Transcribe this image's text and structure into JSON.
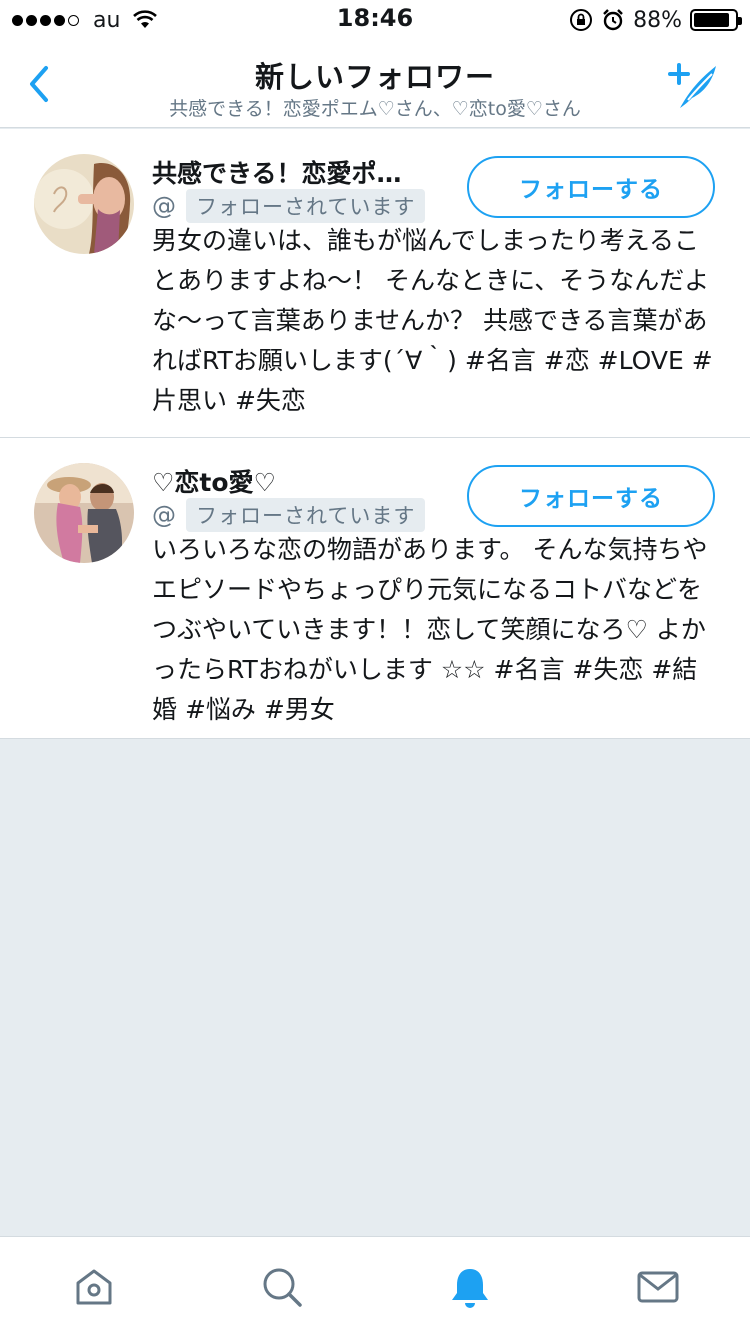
{
  "status_bar": {
    "carrier": "au",
    "time": "18:46",
    "battery_percent": "88%",
    "battery_level": 0.88,
    "signal_dots_filled": 4,
    "signal_dots_total": 5
  },
  "header": {
    "title": "新しいフォロワー",
    "subtitle": "共感できる！恋愛ポエム♡さん、♡恋to愛♡さん",
    "back_icon": "chevron-left-icon",
    "compose_icon": "compose-tweet-icon"
  },
  "followers": [
    {
      "name": "共感できる！恋愛ポ…",
      "handle_prefix": "@",
      "follows_you": "フォローされています",
      "follow_button": "フォローする",
      "bio": "男女の違いは、誰もが悩んでしまったり考えることありますよね〜！ そんなときに、そうなんだよな〜って言葉ありませんか？ 共感できる言葉があればRTお願いします(´∀｀) #名言 #恋 #LOVE #片思い #失恋"
    },
    {
      "name": "♡恋to愛♡",
      "handle_prefix": "@",
      "follows_you": "フォローされています",
      "follow_button": "フォローする",
      "bio": "いろいろな恋の物語があります。 そんな気持ちやエピソードやちょっぴり元気になるコトバなどをつぶやいていきます！！恋して笑顔になろ♡ よかったらRTおねがいします ☆☆ #名言 #失恋 #結婚 #悩み #男女"
    }
  ],
  "tab_bar": {
    "tabs": [
      "home-icon",
      "search-icon",
      "notifications-bell-icon",
      "messages-envelope-icon"
    ],
    "active": "notifications-bell-icon"
  },
  "colors": {
    "accent": "#1da1f2",
    "muted": "#657786",
    "background": "#e6ecf0",
    "divider": "#d4dbe0"
  }
}
